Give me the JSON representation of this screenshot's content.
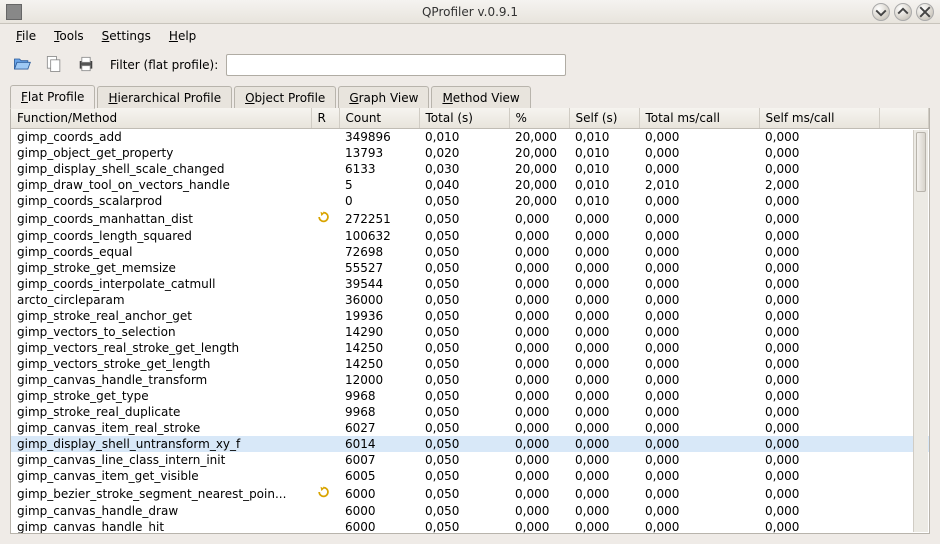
{
  "window": {
    "title": "QProfiler v.0.9.1"
  },
  "menu": {
    "file": "File",
    "tools": "Tools",
    "settings": "Settings",
    "help": "Help"
  },
  "toolbar": {
    "filter_label": "Filter (flat profile):",
    "filter_value": ""
  },
  "tabs": {
    "flat": "Flat Profile",
    "hier": "Hierarchical Profile",
    "obj": "Object Profile",
    "graph": "Graph View",
    "method": "Method View"
  },
  "columns": {
    "fn": "Function/Method",
    "r": "R",
    "count": "Count",
    "total": "Total (s)",
    "pct": "%",
    "self": "Self (s)",
    "tmc": "Total ms/call",
    "smc": "Self ms/call"
  },
  "rows": [
    {
      "fn": "gimp_coords_add",
      "r": "",
      "count": "349896",
      "total": "0,010",
      "pct": "20,000",
      "self": "0,010",
      "tmc": "0,000",
      "smc": "0,000"
    },
    {
      "fn": "gimp_object_get_property",
      "r": "",
      "count": "13793",
      "total": "0,020",
      "pct": "20,000",
      "self": "0,010",
      "tmc": "0,000",
      "smc": "0,000"
    },
    {
      "fn": "gimp_display_shell_scale_changed",
      "r": "",
      "count": "6133",
      "total": "0,030",
      "pct": "20,000",
      "self": "0,010",
      "tmc": "0,000",
      "smc": "0,000"
    },
    {
      "fn": "gimp_draw_tool_on_vectors_handle",
      "r": "",
      "count": "5",
      "total": "0,040",
      "pct": "20,000",
      "self": "0,010",
      "tmc": "2,010",
      "smc": "2,000"
    },
    {
      "fn": "gimp_coords_scalarprod",
      "r": "",
      "count": "0",
      "total": "0,050",
      "pct": "20,000",
      "self": "0,010",
      "tmc": "0,000",
      "smc": "0,000"
    },
    {
      "fn": "gimp_coords_manhattan_dist",
      "r": "y",
      "count": "272251",
      "total": "0,050",
      "pct": "0,000",
      "self": "0,000",
      "tmc": "0,000",
      "smc": "0,000"
    },
    {
      "fn": "gimp_coords_length_squared",
      "r": "",
      "count": "100632",
      "total": "0,050",
      "pct": "0,000",
      "self": "0,000",
      "tmc": "0,000",
      "smc": "0,000"
    },
    {
      "fn": "gimp_coords_equal",
      "r": "",
      "count": "72698",
      "total": "0,050",
      "pct": "0,000",
      "self": "0,000",
      "tmc": "0,000",
      "smc": "0,000"
    },
    {
      "fn": "gimp_stroke_get_memsize",
      "r": "",
      "count": "55527",
      "total": "0,050",
      "pct": "0,000",
      "self": "0,000",
      "tmc": "0,000",
      "smc": "0,000"
    },
    {
      "fn": "gimp_coords_interpolate_catmull",
      "r": "",
      "count": "39544",
      "total": "0,050",
      "pct": "0,000",
      "self": "0,000",
      "tmc": "0,000",
      "smc": "0,000"
    },
    {
      "fn": "arcto_circleparam",
      "r": "",
      "count": "36000",
      "total": "0,050",
      "pct": "0,000",
      "self": "0,000",
      "tmc": "0,000",
      "smc": "0,000"
    },
    {
      "fn": "gimp_stroke_real_anchor_get",
      "r": "",
      "count": "19936",
      "total": "0,050",
      "pct": "0,000",
      "self": "0,000",
      "tmc": "0,000",
      "smc": "0,000"
    },
    {
      "fn": "gimp_vectors_to_selection",
      "r": "",
      "count": "14290",
      "total": "0,050",
      "pct": "0,000",
      "self": "0,000",
      "tmc": "0,000",
      "smc": "0,000"
    },
    {
      "fn": "gimp_vectors_real_stroke_get_length",
      "r": "",
      "count": "14250",
      "total": "0,050",
      "pct": "0,000",
      "self": "0,000",
      "tmc": "0,000",
      "smc": "0,000"
    },
    {
      "fn": "gimp_vectors_stroke_get_length",
      "r": "",
      "count": "14250",
      "total": "0,050",
      "pct": "0,000",
      "self": "0,000",
      "tmc": "0,000",
      "smc": "0,000"
    },
    {
      "fn": "gimp_canvas_handle_transform",
      "r": "",
      "count": "12000",
      "total": "0,050",
      "pct": "0,000",
      "self": "0,000",
      "tmc": "0,000",
      "smc": "0,000"
    },
    {
      "fn": "gimp_stroke_get_type",
      "r": "",
      "count": "9968",
      "total": "0,050",
      "pct": "0,000",
      "self": "0,000",
      "tmc": "0,000",
      "smc": "0,000"
    },
    {
      "fn": "gimp_stroke_real_duplicate",
      "r": "",
      "count": "9968",
      "total": "0,050",
      "pct": "0,000",
      "self": "0,000",
      "tmc": "0,000",
      "smc": "0,000"
    },
    {
      "fn": "gimp_canvas_item_real_stroke",
      "r": "",
      "count": "6027",
      "total": "0,050",
      "pct": "0,000",
      "self": "0,000",
      "tmc": "0,000",
      "smc": "0,000"
    },
    {
      "fn": "gimp_display_shell_untransform_xy_f",
      "r": "",
      "count": "6014",
      "total": "0,050",
      "pct": "0,000",
      "self": "0,000",
      "tmc": "0,000",
      "smc": "0,000",
      "selected": true
    },
    {
      "fn": "gimp_canvas_line_class_intern_init",
      "r": "",
      "count": "6007",
      "total": "0,050",
      "pct": "0,000",
      "self": "0,000",
      "tmc": "0,000",
      "smc": "0,000"
    },
    {
      "fn": "gimp_canvas_item_get_visible",
      "r": "",
      "count": "6005",
      "total": "0,050",
      "pct": "0,000",
      "self": "0,000",
      "tmc": "0,000",
      "smc": "0,000"
    },
    {
      "fn": "gimp_bezier_stroke_segment_nearest_poin...",
      "r": "y",
      "count": "6000",
      "total": "0,050",
      "pct": "0,000",
      "self": "0,000",
      "tmc": "0,000",
      "smc": "0,000"
    },
    {
      "fn": "gimp_canvas_handle_draw",
      "r": "",
      "count": "6000",
      "total": "0,050",
      "pct": "0,000",
      "self": "0,000",
      "tmc": "0,000",
      "smc": "0,000"
    },
    {
      "fn": "gimp_canvas_handle_hit",
      "r": "",
      "count": "6000",
      "total": "0,050",
      "pct": "0,000",
      "self": "0,000",
      "tmc": "0,000",
      "smc": "0,000"
    }
  ]
}
